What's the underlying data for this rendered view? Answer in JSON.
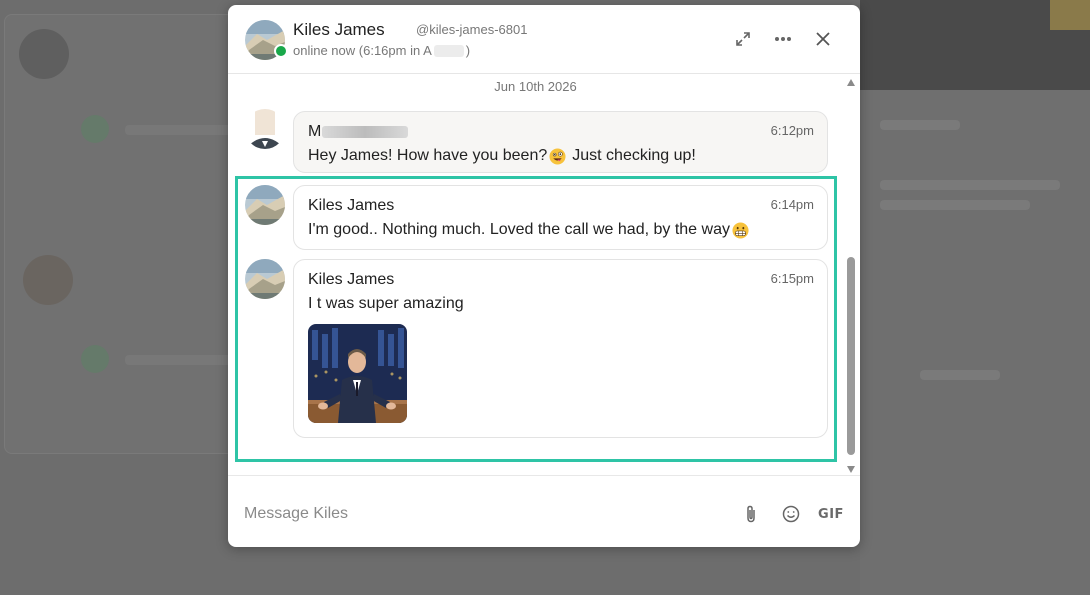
{
  "header": {
    "name": "Kiles James",
    "handle": "@kiles-james-6801",
    "status_prefix": "online now (6:16pm in A",
    "status_suffix": ")",
    "expand_icon": "expand-icon",
    "more_icon": "more-dots-icon",
    "close_icon": "close-icon",
    "online_color": "#19a84a"
  },
  "date_separator": "Jun 10th 2026",
  "messages": [
    {
      "sender_initial": "M",
      "time": "6:12pm",
      "text": "Hey James! How have you been?",
      "text_after_emoji": "Just checking up!"
    },
    {
      "sender": "Kiles James",
      "time": "6:14pm",
      "text": "I'm good.. Nothing much. Loved the call we had, by the way"
    },
    {
      "sender": "Kiles James",
      "time": "6:15pm",
      "text": "I t was super amazing",
      "attachment": "gif"
    }
  ],
  "composer": {
    "placeholder": "Message Kiles",
    "gif_label": "GIF",
    "attach_icon": "paperclip-icon",
    "emoji_icon": "smiley-icon"
  },
  "highlight_color": "#2ec4a6"
}
